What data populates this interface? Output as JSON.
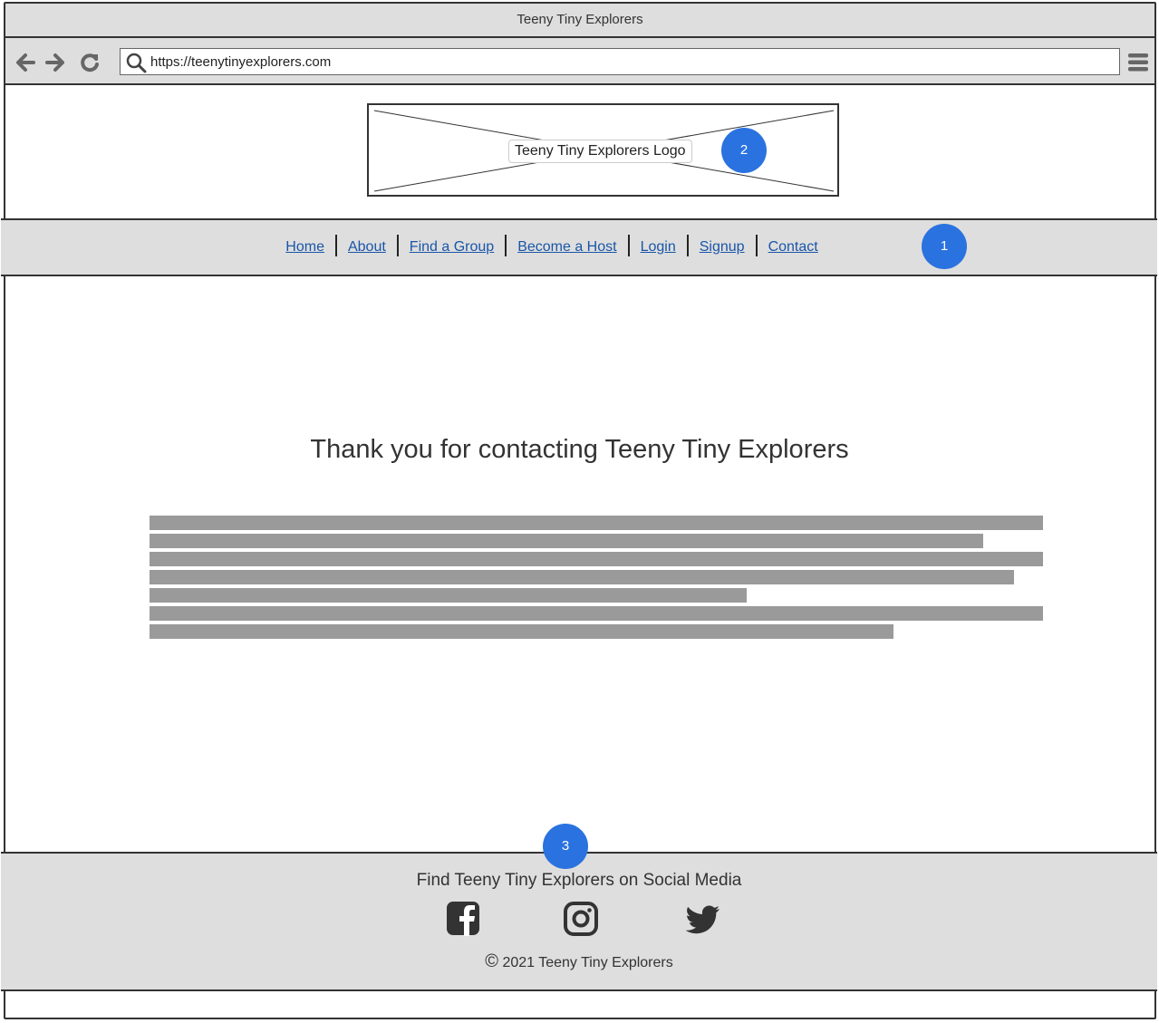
{
  "browser": {
    "window_title": "Teeny Tiny Explorers",
    "url": "https://teenytinyexplorers.com",
    "icons": {
      "back": "arrow-left-icon",
      "forward": "arrow-right-icon",
      "reload": "reload-icon",
      "search": "search-icon",
      "menu": "hamburger-menu-icon"
    }
  },
  "header": {
    "logo_label": "Teeny Tiny Explorers Logo",
    "logo_badge": "2"
  },
  "nav": {
    "badge": "1",
    "items": [
      {
        "label": "Home"
      },
      {
        "label": "About"
      },
      {
        "label": "Find a Group"
      },
      {
        "label": "Become a Host"
      },
      {
        "label": "Login"
      },
      {
        "label": "Signup"
      },
      {
        "label": "Contact"
      }
    ]
  },
  "main": {
    "heading": "Thank you for contacting Teeny Tiny Explorers",
    "placeholder_line_widths": [
      1.0,
      0.933,
      1.0,
      0.968,
      0.668,
      1.0,
      0.833
    ]
  },
  "footer": {
    "badge": "3",
    "title": "Find Teeny Tiny Explorers on Social Media",
    "social_icons": [
      "facebook-icon",
      "instagram-icon",
      "twitter-icon"
    ],
    "copyright_symbol": "©",
    "copyright": "2021 Teeny Tiny Explorers"
  },
  "colors": {
    "link": "#1a56a8",
    "badge": "#2a72e0",
    "bar_background": "#dedede",
    "placeholder_text": "#9a9a9a"
  }
}
